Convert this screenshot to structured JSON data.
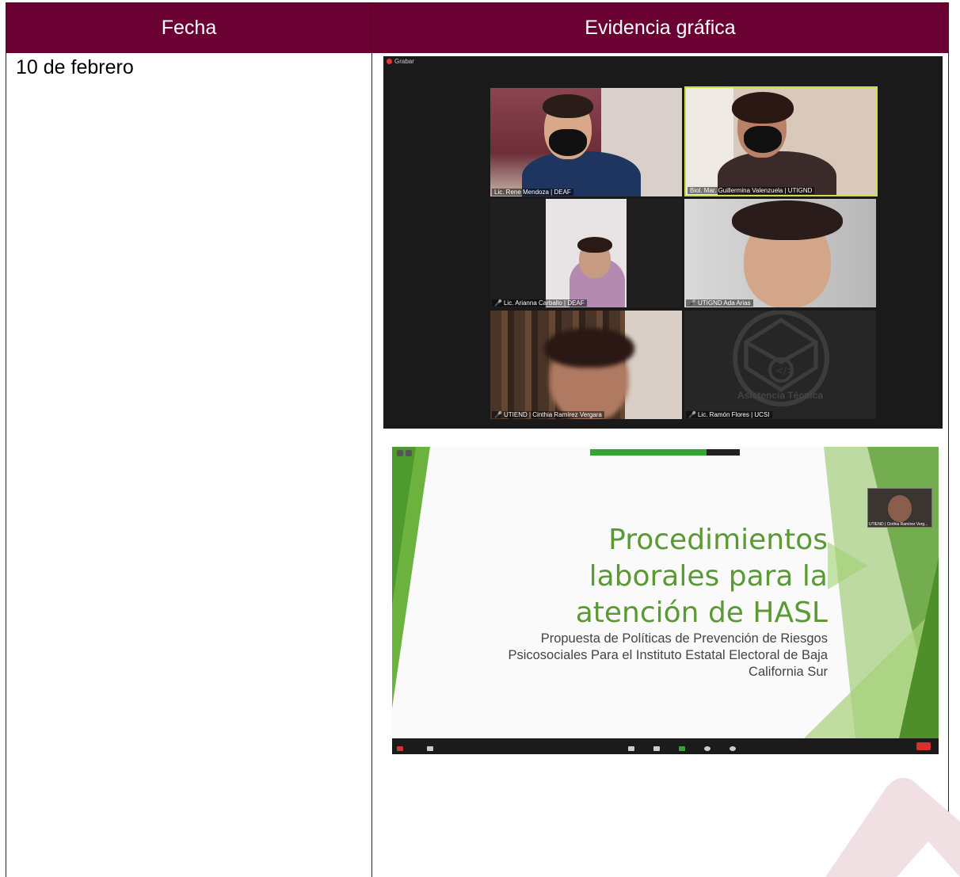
{
  "table": {
    "header_fecha": "Fecha",
    "header_evidencia": "Evidencia gráfica",
    "date": "10 de febrero"
  },
  "meeting": {
    "record_label": "Grabar",
    "participants": [
      "Lic. Rene Mendoza | DEAF",
      "Biol. Mar. Guillermina Valenzuela | UTIGND",
      "Lic. Arianna Carballo | DEAF",
      "UTIGND Ada Arias",
      "UTIEND | Cinthia Ramírez Vergara",
      "Lic. Ramón Flores | UCSI"
    ],
    "assist_label": "Asistencia Técnica"
  },
  "slide": {
    "title_lines": [
      "Procedimientos",
      "laborales para la",
      "atención de HASL"
    ],
    "subtitle_lines": [
      "Propuesta de Políticas de Prevención de Riesgos",
      "Psicosociales Para el Instituto Estatal Electoral de Baja",
      "California Sur"
    ],
    "thumb_label": "UTIEND | Cinthia Ramírez Verg..."
  },
  "colors": {
    "header_bg": "#6b0032",
    "slide_green": "#5a9a34",
    "watermark": "#f0dfe3"
  }
}
